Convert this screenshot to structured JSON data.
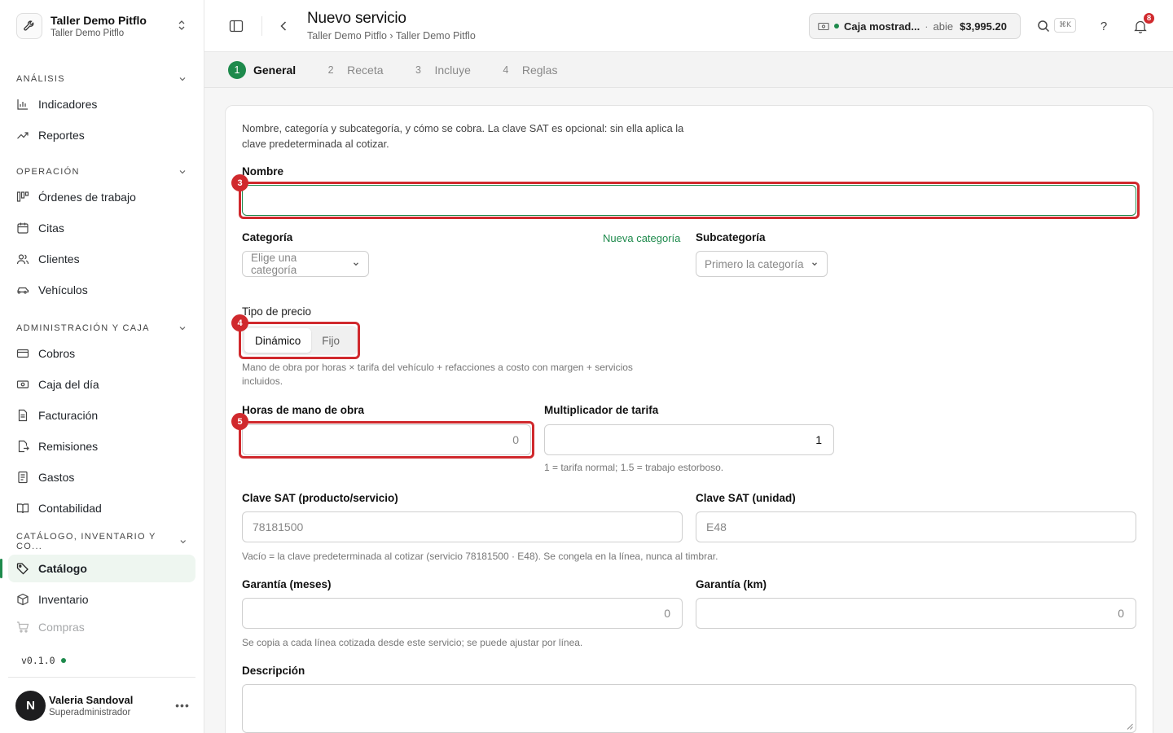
{
  "org": {
    "name": "Taller Demo Pitflo",
    "sub": "Taller Demo Pitflo"
  },
  "sidebar": {
    "sections": [
      {
        "title": "ANÁLISIS",
        "items": [
          {
            "label": "Indicadores",
            "icon": "bar-chart-icon"
          },
          {
            "label": "Reportes",
            "icon": "trend-icon"
          }
        ]
      },
      {
        "title": "OPERACIÓN",
        "items": [
          {
            "label": "Órdenes de trabajo",
            "icon": "kanban-icon"
          },
          {
            "label": "Citas",
            "icon": "calendar-icon"
          },
          {
            "label": "Clientes",
            "icon": "users-icon"
          },
          {
            "label": "Vehículos",
            "icon": "car-icon"
          }
        ]
      },
      {
        "title": "ADMINISTRACIÓN Y CAJA",
        "items": [
          {
            "label": "Cobros",
            "icon": "wallet-icon"
          },
          {
            "label": "Caja del día",
            "icon": "cash-icon"
          },
          {
            "label": "Facturación",
            "icon": "file-icon"
          },
          {
            "label": "Remisiones",
            "icon": "file-export-icon"
          },
          {
            "label": "Gastos",
            "icon": "receipt-icon"
          },
          {
            "label": "Contabilidad",
            "icon": "book-icon"
          }
        ]
      },
      {
        "title": "CATÁLOGO, INVENTARIO Y CO...",
        "items": [
          {
            "label": "Catálogo",
            "icon": "tag-icon",
            "active": true
          },
          {
            "label": "Inventario",
            "icon": "box-icon"
          },
          {
            "label": "Compras",
            "icon": "cart-icon"
          }
        ]
      }
    ],
    "version": "v0.1.0"
  },
  "user": {
    "name": "Valeria Sandoval",
    "role": "Superadministrador",
    "initial": "N"
  },
  "header": {
    "title": "Nuevo servicio",
    "breadcrumb": "Taller Demo Pitflo › Taller Demo Pitflo",
    "caja": {
      "name": "Caja mostrad...",
      "sep": "·",
      "status": "abie",
      "amount": "$3,995.20"
    },
    "shortcut": "⌘K",
    "help": "?",
    "notifications": "8"
  },
  "steps": [
    {
      "n": "1",
      "label": "General",
      "active": true
    },
    {
      "n": "2",
      "label": "Receta"
    },
    {
      "n": "3",
      "label": "Incluye"
    },
    {
      "n": "4",
      "label": "Reglas"
    }
  ],
  "form": {
    "intro": "Nombre, categoría y subcategoría, y cómo se cobra. La clave SAT es opcional: sin ella aplica la clave predeterminada al cotizar.",
    "nombre_label": "Nombre",
    "nombre_value": "",
    "categoria_label": "Categoría",
    "nueva_categoria": "Nueva categoría",
    "categoria_placeholder": "Elige una categoría",
    "subcategoria_label": "Subcategoría",
    "subcategoria_placeholder": "Primero la categoría",
    "tipo_label": "Tipo de precio",
    "tipo_options": [
      "Dinámico",
      "Fijo"
    ],
    "tipo_selected": "Dinámico",
    "tipo_help": "Mano de obra por horas × tarifa del vehículo + refacciones a costo con margen + servicios incluidos.",
    "horas_label": "Horas de mano de obra",
    "horas_placeholder": "0",
    "mult_label": "Multiplicador de tarifa",
    "mult_value": "1",
    "mult_help": "1 = tarifa normal; 1.5 = trabajo estorboso.",
    "sat_prod_label": "Clave SAT (producto/servicio)",
    "sat_prod_placeholder": "78181500",
    "sat_unit_label": "Clave SAT (unidad)",
    "sat_unit_placeholder": "E48",
    "sat_help": "Vacío = la clave predeterminada al cotizar (servicio 78181500 · E48). Se congela en la línea, nunca al timbrar.",
    "gar_meses_label": "Garantía (meses)",
    "gar_meses_placeholder": "0",
    "gar_km_label": "Garantía (km)",
    "gar_km_placeholder": "0",
    "gar_help": "Se copia a cada línea cotizada desde este servicio; se puede ajustar por línea.",
    "desc_label": "Descripción"
  },
  "highlights": [
    "3",
    "4",
    "5"
  ],
  "colors": {
    "accent": "#1e8a4c",
    "highlight": "#d0292d"
  }
}
